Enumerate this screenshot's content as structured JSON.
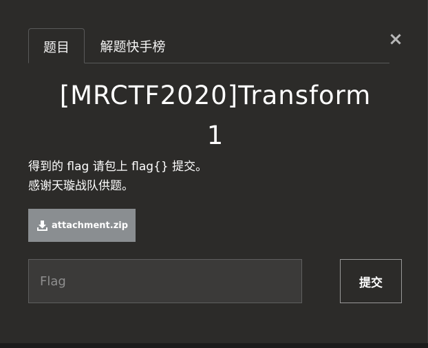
{
  "tabs": [
    {
      "label": "题目",
      "active": true
    },
    {
      "label": "解题快手榜",
      "active": false
    }
  ],
  "close_symbol": "×",
  "challenge": {
    "title_line1": "[MRCTF2020]Transform",
    "title_line2": "1",
    "description_line1": "得到的 flag 请包上 flag{} 提交。",
    "description_line2": "感谢天璇战队供题。"
  },
  "attachment": {
    "label": "attachment.zip",
    "icon": "download-icon"
  },
  "flag_input": {
    "value": "",
    "placeholder": "Flag"
  },
  "submit_button": {
    "label": "提交"
  },
  "colors": {
    "modal_background": "#2c2b29",
    "attachment_button": "#8a8e91",
    "input_background": "#3b3a39"
  }
}
